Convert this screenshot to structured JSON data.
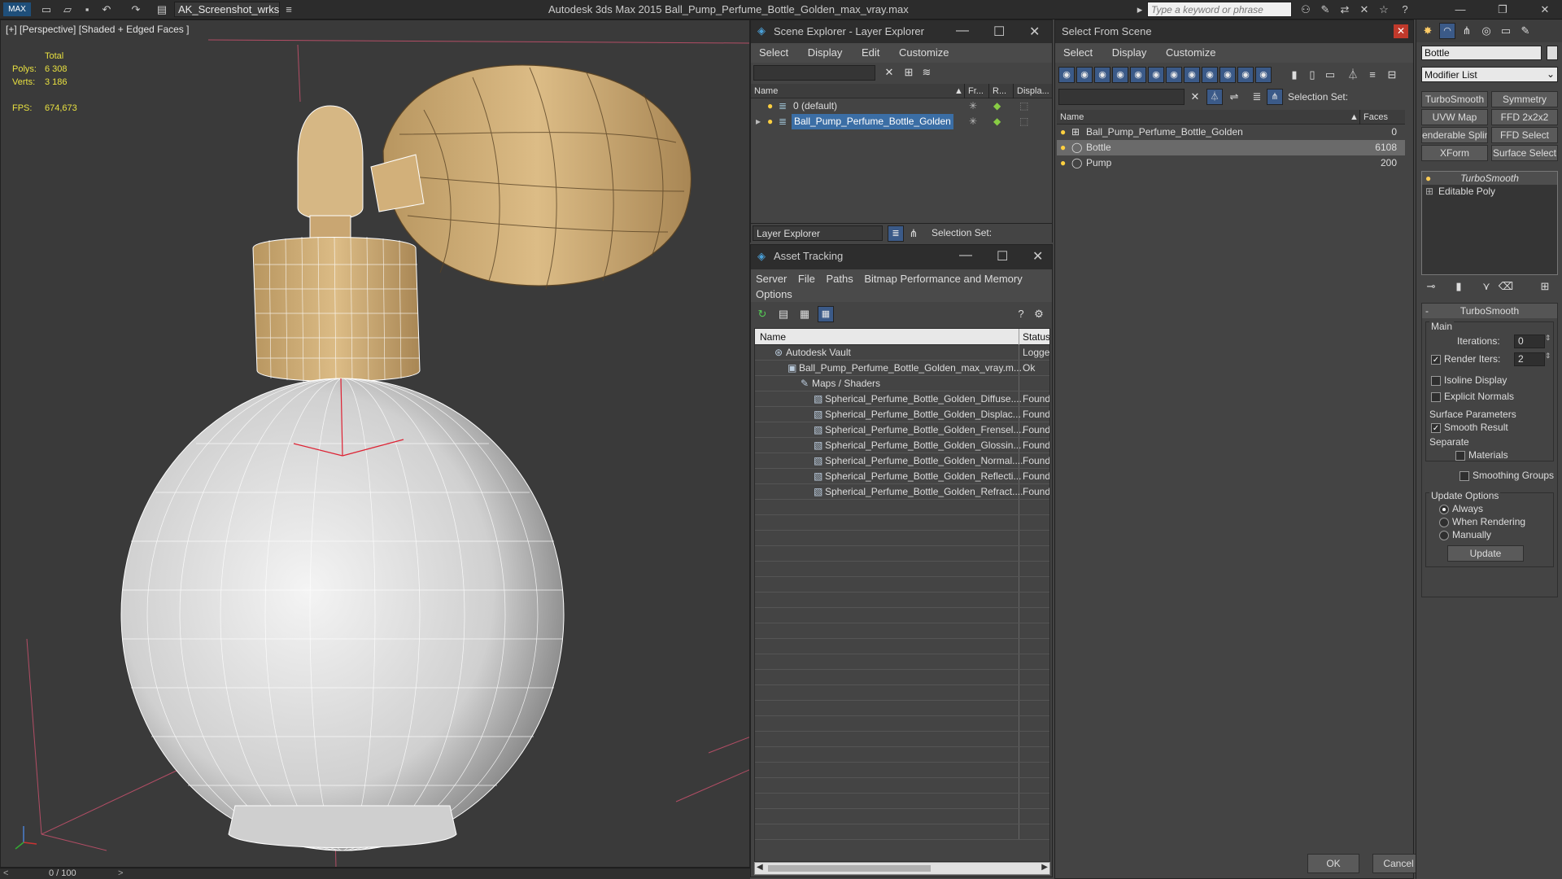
{
  "titlebar": {
    "workspace": "AK_Screenshot_wrksp",
    "app_title": "Autodesk 3ds Max  2015    Ball_Pump_Perfume_Bottle_Golden_max_vray.max",
    "search_placeholder": "Type a keyword or phrase"
  },
  "viewport": {
    "label": "[+] [Perspective] [Shaded + Edged Faces ]",
    "stats": {
      "total": "Total",
      "polys_label": "Polys:",
      "polys": "6 308",
      "verts_label": "Verts:",
      "verts": "3 186",
      "fps_label": "FPS:",
      "fps": "674,673"
    },
    "timeline": "0 / 100"
  },
  "scene_explorer": {
    "title": "Scene Explorer - Layer Explorer",
    "menu": [
      "Select",
      "Display",
      "Edit",
      "Customize"
    ],
    "columns": [
      "Name",
      "Fr...",
      "R...",
      "Displa..."
    ],
    "rows": [
      "0 (default)",
      "Ball_Pump_Perfume_Bottle_Golden"
    ],
    "footer_dropdown": "Layer Explorer",
    "selection_set": "Selection Set:"
  },
  "asset_tracking": {
    "title": "Asset Tracking",
    "menu": [
      "Server",
      "File",
      "Paths",
      "Bitmap Performance and Memory",
      "Options"
    ],
    "columns": [
      "Name",
      "Status"
    ],
    "rows": [
      {
        "name": "Autodesk Vault",
        "status": "Logged",
        "indent": 0
      },
      {
        "name": "Ball_Pump_Perfume_Bottle_Golden_max_vray.m...",
        "status": "Ok",
        "indent": 1
      },
      {
        "name": "Maps / Shaders",
        "status": "",
        "indent": 2
      },
      {
        "name": "Spherical_Perfume_Bottle_Golden_Diffuse....",
        "status": "Found",
        "indent": 3
      },
      {
        "name": "Spherical_Perfume_Bottle_Golden_Displac...",
        "status": "Found",
        "indent": 3
      },
      {
        "name": "Spherical_Perfume_Bottle_Golden_Frensel....",
        "status": "Found",
        "indent": 3
      },
      {
        "name": "Spherical_Perfume_Bottle_Golden_Glossin...",
        "status": "Found",
        "indent": 3
      },
      {
        "name": "Spherical_Perfume_Bottle_Golden_Normal....",
        "status": "Found",
        "indent": 3
      },
      {
        "name": "Spherical_Perfume_Bottle_Golden_Reflecti...",
        "status": "Found",
        "indent": 3
      },
      {
        "name": "Spherical_Perfume_Bottle_Golden_Refract....",
        "status": "Found",
        "indent": 3
      }
    ]
  },
  "select_from_scene": {
    "title": "Select From Scene",
    "menu": [
      "Select",
      "Display",
      "Customize"
    ],
    "selection_set": "Selection Set:",
    "columns": [
      "Name",
      "Faces"
    ],
    "rows": [
      {
        "name": "Ball_Pump_Perfume_Bottle_Golden",
        "faces": "0"
      },
      {
        "name": "Bottle",
        "faces": "6108"
      },
      {
        "name": "Pump",
        "faces": "200"
      }
    ],
    "ok": "OK",
    "cancel": "Cancel"
  },
  "command_panel": {
    "object_name": "Bottle",
    "modifier_list": "Modifier List",
    "buttons": [
      "TurboSmooth",
      "Symmetry",
      "UVW Map",
      "FFD 2x2x2",
      "enderable Splin",
      "FFD Select",
      "XForm",
      "Surface Select"
    ],
    "stack": [
      "TurboSmooth",
      "Editable Poly"
    ],
    "rollout_title": "TurboSmooth",
    "main": "Main",
    "iterations_label": "Iterations:",
    "iterations": "0",
    "render_iters_label": "Render Iters:",
    "render_iters": "2",
    "isoline": "Isoline Display",
    "explicit_normals": "Explicit Normals",
    "surface_params": "Surface Parameters",
    "smooth_result": "Smooth Result",
    "separate": "Separate",
    "materials": "Materials",
    "smoothing_groups": "Smoothing Groups",
    "update_options": "Update Options",
    "always": "Always",
    "when_rendering": "When Rendering",
    "manually": "Manually",
    "update": "Update"
  },
  "colors": {
    "selection": "#3b6ea5",
    "stats": "#e8e040",
    "bottle_tan": "#c8a46a"
  }
}
